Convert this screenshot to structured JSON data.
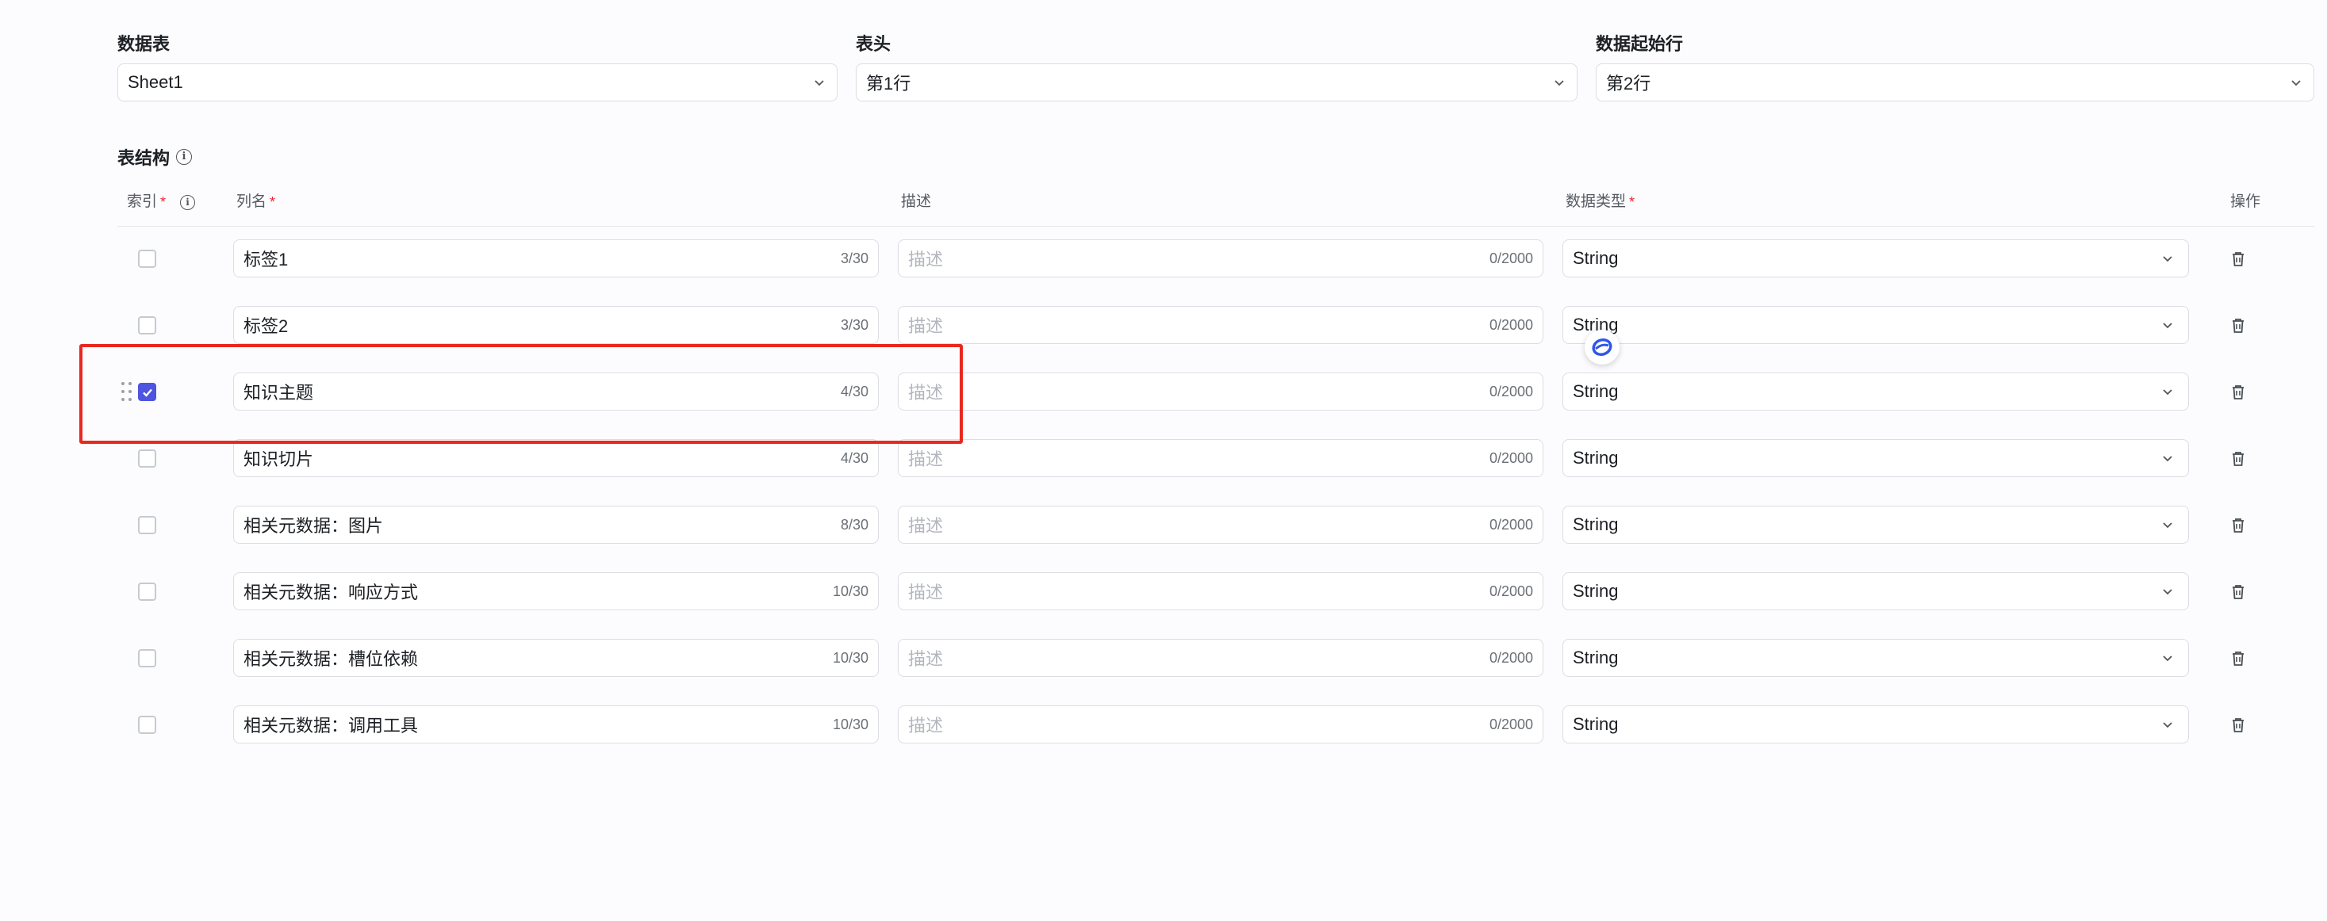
{
  "config": {
    "sheet": {
      "label": "数据表",
      "value": "Sheet1"
    },
    "header": {
      "label": "表头",
      "value": "第1行"
    },
    "start_row": {
      "label": "数据起始行",
      "value": "第2行"
    }
  },
  "section_title": "表结构",
  "columns": {
    "index": "索引",
    "name": "列名",
    "desc": "描述",
    "type": "数据类型",
    "action": "操作",
    "required_mark": "*"
  },
  "rows": [
    {
      "checked": false,
      "name": "标签1",
      "name_count": "3/30",
      "desc_placeholder": "描述",
      "desc_count": "0/2000",
      "type": "String"
    },
    {
      "checked": false,
      "name": "标签2",
      "name_count": "3/30",
      "desc_placeholder": "描述",
      "desc_count": "0/2000",
      "type": "String"
    },
    {
      "checked": true,
      "name": "知识主题",
      "name_count": "4/30",
      "desc_placeholder": "描述",
      "desc_count": "0/2000",
      "type": "String"
    },
    {
      "checked": false,
      "name": "知识切片",
      "name_count": "4/30",
      "desc_placeholder": "描述",
      "desc_count": "0/2000",
      "type": "String"
    },
    {
      "checked": false,
      "name": "相关元数据：图片",
      "name_count": "8/30",
      "desc_placeholder": "描述",
      "desc_count": "0/2000",
      "type": "String"
    },
    {
      "checked": false,
      "name": "相关元数据：响应方式",
      "name_count": "10/30",
      "desc_placeholder": "描述",
      "desc_count": "0/2000",
      "type": "String"
    },
    {
      "checked": false,
      "name": "相关元数据：槽位依赖",
      "name_count": "10/30",
      "desc_placeholder": "描述",
      "desc_count": "0/2000",
      "type": "String"
    },
    {
      "checked": false,
      "name": "相关元数据：调用工具",
      "name_count": "10/30",
      "desc_placeholder": "描述",
      "desc_count": "0/2000",
      "type": "String"
    }
  ],
  "colors": {
    "accent": "#4c54e0",
    "highlight": "#e8281f",
    "required": "#f5222d"
  },
  "icons": [
    "chevron-down-icon",
    "info-icon",
    "trash-icon",
    "drag-handle-icon",
    "check-icon",
    "assistant-icon"
  ]
}
